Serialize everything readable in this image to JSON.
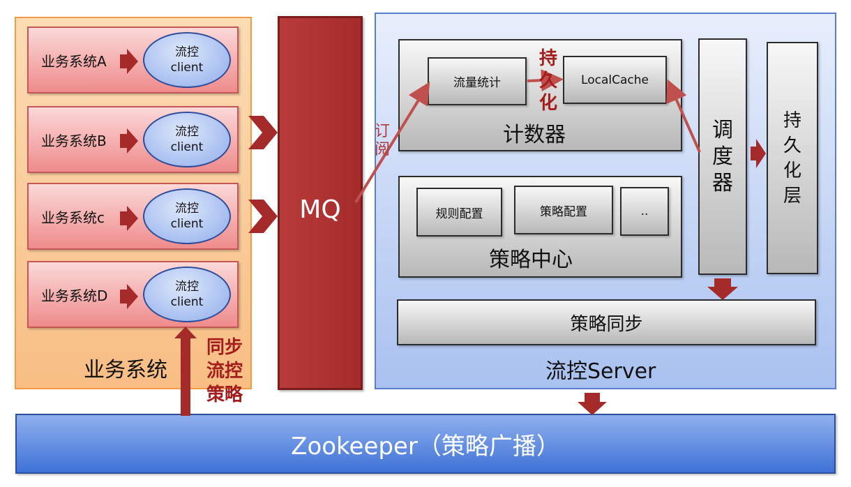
{
  "business_systems": {
    "title": "业务系统",
    "rows": [
      {
        "label": "业务系统A",
        "client_line1": "流控",
        "client_line2": "client"
      },
      {
        "label": "业务系统B",
        "client_line1": "流控",
        "client_line2": "client"
      },
      {
        "label": "业务系统c",
        "client_line1": "流控",
        "client_line2": "client"
      },
      {
        "label": "业务系统D",
        "client_line1": "流控",
        "client_line2": "client"
      }
    ]
  },
  "mq": {
    "label": "MQ"
  },
  "server": {
    "title": "流控Server",
    "counter": {
      "title": "计数器",
      "traffic_stats": "流量统计",
      "local_cache": "LocalCache"
    },
    "strategy_center": {
      "title": "策略中心",
      "rule_config": "规则配置",
      "policy_config": "策略配置",
      "more": ".."
    },
    "scheduler": {
      "line1": "调",
      "line2": "度",
      "line3": "器"
    },
    "persistence": {
      "line1": "持",
      "line2": "久",
      "line3": "化",
      "line4": "层"
    },
    "strategy_sync": "策略同步"
  },
  "zookeeper": {
    "label": "Zookeeper（策略广播）"
  },
  "annotations": {
    "persist": [
      "持",
      "久",
      "化"
    ],
    "subscribe": [
      "订",
      "阅"
    ],
    "sync_strategy": [
      "同步",
      "流控",
      "策略"
    ]
  },
  "colors": {
    "arrow_red": "#a52b2b",
    "text_red": "#a51c1c",
    "panel_orange": "#f8be84",
    "panel_blue": "#a9c1ef",
    "zookeeper_blue": "#3f72d6"
  }
}
